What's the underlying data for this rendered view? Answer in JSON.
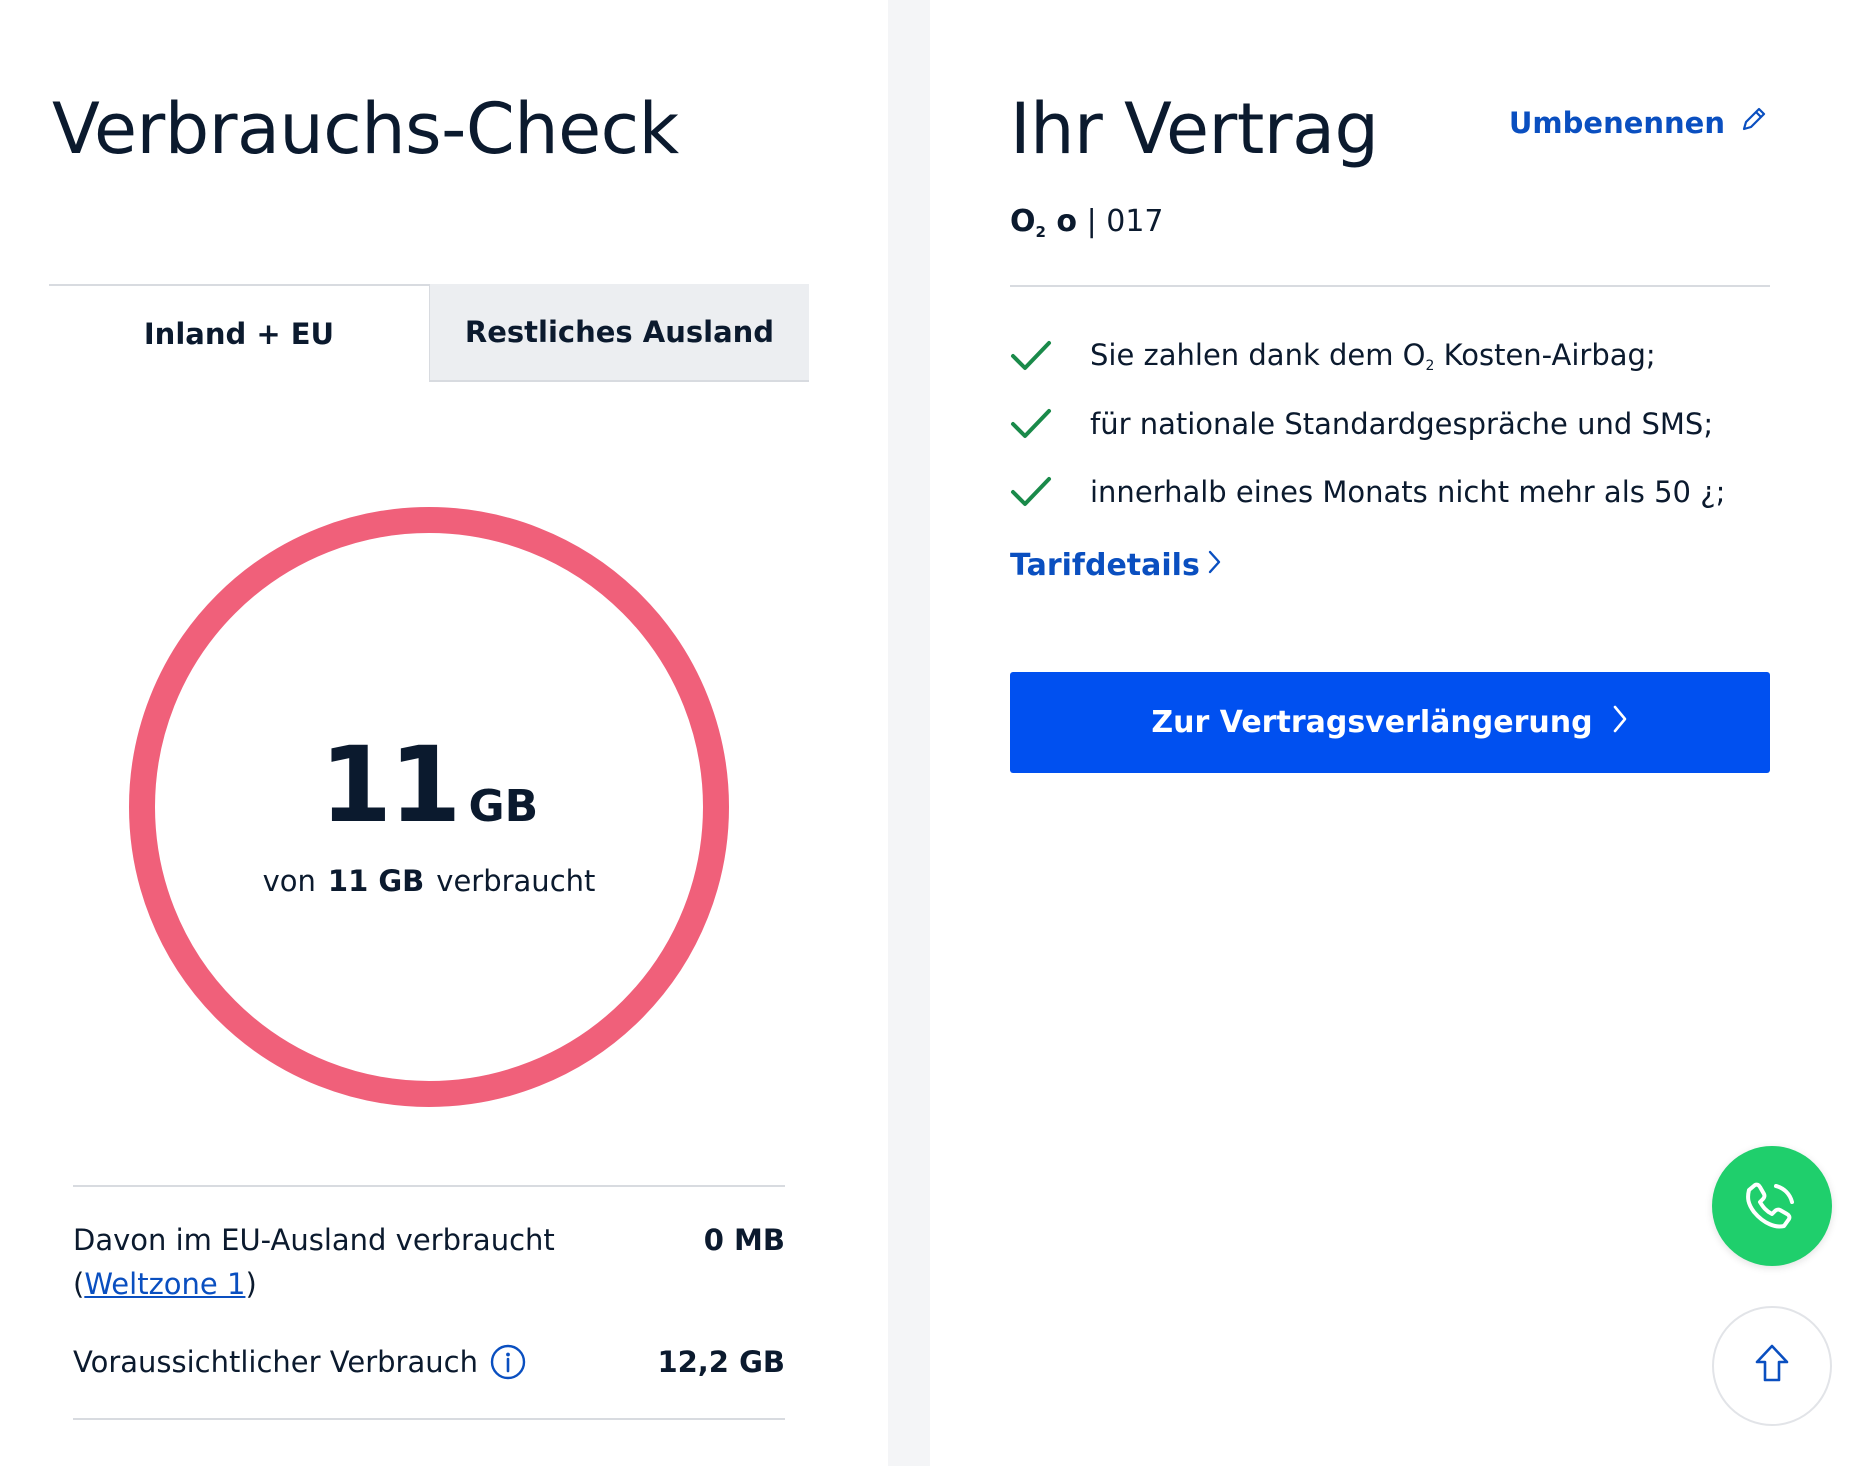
{
  "usage_card": {
    "title": "Verbrauchs-Check",
    "tabs": [
      {
        "label": "Inland + EU",
        "active": true
      },
      {
        "label": "Restliches Ausland",
        "active": false
      }
    ],
    "gauge": {
      "used_value": "11",
      "used_unit": "GB",
      "caption_prefix": "von",
      "caption_total": "11 GB",
      "caption_suffix": "verbraucht",
      "fill_fraction": 1.0,
      "ring_color": "#f0607a"
    },
    "eu_usage": {
      "label_prefix": "Davon im EU-Ausland verbraucht (",
      "link_text": "Weltzone 1",
      "label_suffix": ")",
      "value": "0 MB"
    },
    "forecast": {
      "label": "Voraussichtlicher Verbrauch",
      "value": "12,2 GB",
      "icon": "info-icon"
    }
  },
  "contract_card": {
    "title": "Ihr Vertrag",
    "rename_label": "Umbenennen",
    "rename_icon": "pencil-icon",
    "tariff": {
      "brand_o": "O",
      "brand_sub": "2",
      "brand_suffix": "o",
      "separator": "|",
      "number": "017"
    },
    "features": [
      {
        "pre": "Sie zahlen dank dem O",
        "sub": "2",
        "post": " Kosten-Airbag;"
      },
      {
        "pre": "für nationale Standardgespräche und SMS;",
        "sub": "",
        "post": ""
      },
      {
        "pre": "innerhalb eines Monats nicht mehr als 50 ¿;",
        "sub": "",
        "post": ""
      }
    ],
    "check_color": "#1a8a4a",
    "details_link": "Tarifdetails",
    "cta_label": "Zur Vertragsverlängerung",
    "accent_color": "#0050f0"
  },
  "fabs": {
    "call_icon": "phone-icon",
    "call_color": "#1fcf6c",
    "scroll_icon": "arrow-up-icon"
  }
}
